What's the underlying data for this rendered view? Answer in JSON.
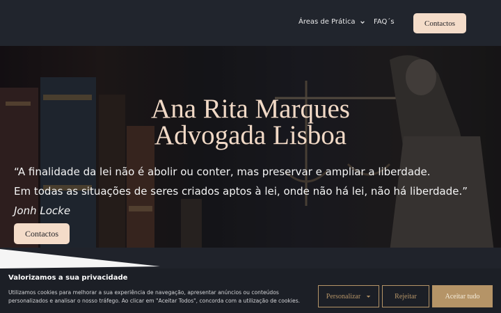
{
  "nav": {
    "areas_label": "Áreas de Prática",
    "faq_label": "FAQ´s",
    "contact_label": "Contactos"
  },
  "hero": {
    "title_line1": "Ana Rita Marques",
    "title_line2": "Advogada Lisboa",
    "quote_line1": "“A finalidade da lei não é abolir ou conter, mas preservar e ampliar a liberdade.",
    "quote_line2": "Em todas as situações de seres criados aptos à lei, onde não há lei, não há liberdade.”",
    "author": "Jonh Locke",
    "contact_label": "Contactos"
  },
  "cookie": {
    "title": "Valorizamos a sua privacidade",
    "text": "Utilizamos cookies para melhorar a sua experiência de navegação, apresentar anúncios ou conteúdos personalizados e analisar o nosso tráfego. Ao clicar em \"Aceitar Todos\", concorda com a utilização de cookies.",
    "personalize_label": "Personalizar",
    "reject_label": "Rejeitar",
    "accept_label": "Aceitar tudo"
  },
  "colors": {
    "header_bg": "#21252d",
    "accent_button": "#f4dcc9",
    "title_color": "#f1d9c6",
    "cookie_gold": "#b59467"
  },
  "icons": {
    "dropdown": "chevron-down-icon",
    "personalize_caret": "caret-down-icon"
  }
}
